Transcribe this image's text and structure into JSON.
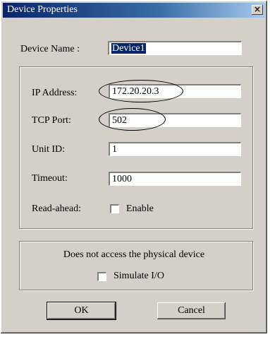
{
  "window": {
    "title": "Device Properties",
    "close_glyph": "×"
  },
  "device_name": {
    "label": "Device Name :",
    "value": "Device1"
  },
  "connection": {
    "ip_address": {
      "label": "IP Address:",
      "value": "172.20.20.3"
    },
    "tcp_port": {
      "label": "TCP Port:",
      "value": "502"
    },
    "unit_id": {
      "label": "Unit ID:",
      "value": "1"
    },
    "timeout": {
      "label": "Timeout:",
      "value": "1000"
    },
    "read_ahead": {
      "label": "Read-ahead:",
      "checkbox_label": "Enable",
      "checked": false
    }
  },
  "simulation": {
    "note": "Does not access the physical device",
    "checkbox_label": "Simulate I/O",
    "checked": false
  },
  "buttons": {
    "ok": "OK",
    "cancel": "Cancel"
  },
  "colors": {
    "dialog_face": "#d4d0c8",
    "title_start": "#0a246a",
    "title_end": "#a6caf0",
    "selection": "#0a246a"
  }
}
